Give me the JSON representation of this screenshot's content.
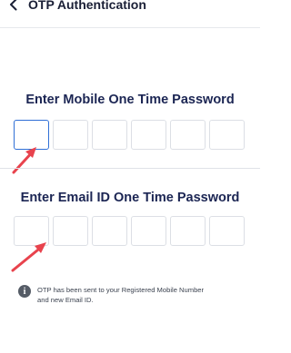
{
  "header": {
    "title": "OTP Authentication",
    "back_icon": "chevron-left-icon"
  },
  "mobile_otp": {
    "title": "Enter Mobile One Time Password",
    "digits": [
      "",
      "",
      "",
      "",
      "",
      ""
    ]
  },
  "email_otp": {
    "title": "Enter Email ID One Time Password",
    "digits": [
      "",
      "",
      "",
      "",
      "",
      ""
    ]
  },
  "info": {
    "icon": "info-icon",
    "line1": "OTP has been sent to your Registered Mobile Number",
    "line2": "and new Email ID."
  },
  "colors": {
    "title": "#1b2553",
    "active_border": "#2f6fd6",
    "annotation_arrow": "#e8434d"
  }
}
